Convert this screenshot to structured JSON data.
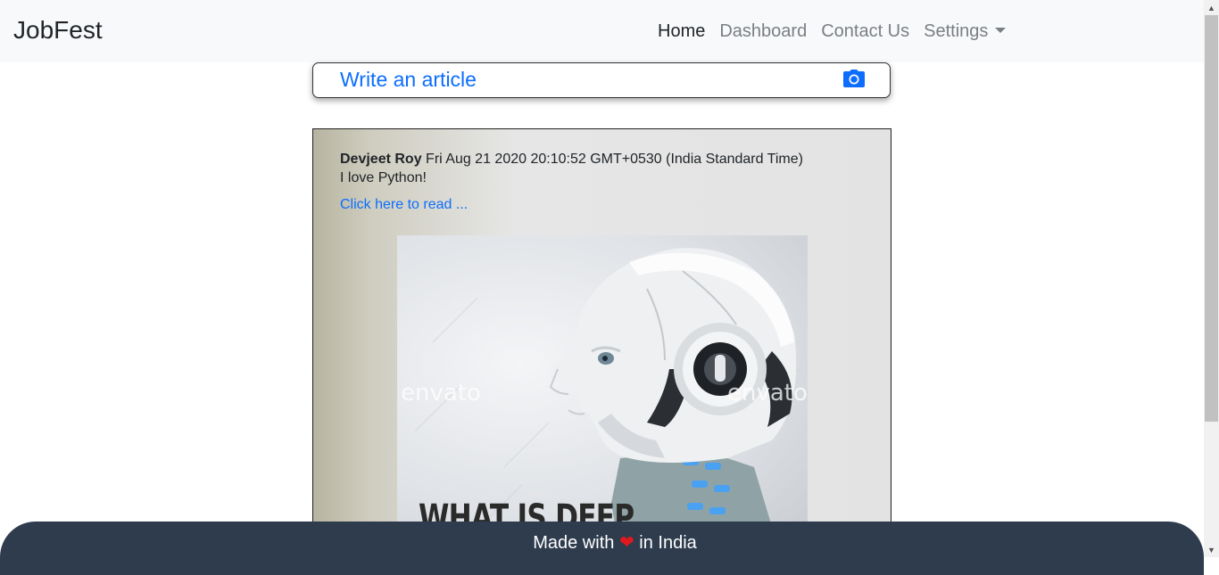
{
  "navbar": {
    "brand": "JobFest",
    "links": [
      "Home",
      "Dashboard",
      "Contact Us",
      "Settings"
    ]
  },
  "composer": {
    "label": "Write an article",
    "icon": "camera-icon"
  },
  "post": {
    "author": "Devjeet Roy",
    "timestamp": "Fri Aug 21 2020 20:10:52 GMT+0530 (India Standard Time)",
    "text": "I love Python!",
    "link": "Click here to read ...",
    "image_title": "WHAT IS DEEP",
    "watermark": "envato"
  },
  "footer": {
    "prefix": "Made with",
    "icon": "heart-icon",
    "suffix": "in India"
  },
  "colors": {
    "accent": "#0d6efd",
    "footer_bg": "#2e3c4e",
    "heart": "#e0191f"
  }
}
